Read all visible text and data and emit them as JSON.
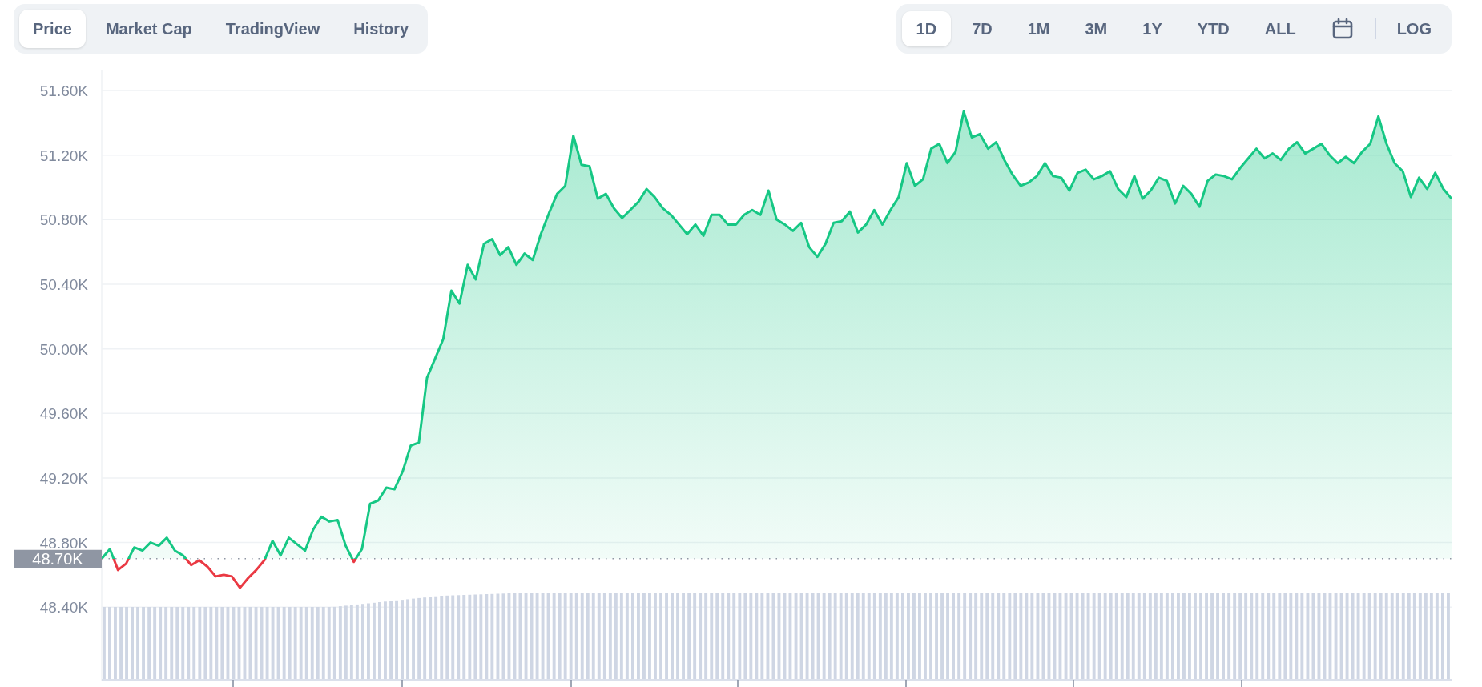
{
  "view_tabs": [
    {
      "label": "Price",
      "selected": true
    },
    {
      "label": "Market Cap",
      "selected": false
    },
    {
      "label": "TradingView",
      "selected": false
    },
    {
      "label": "History",
      "selected": false
    }
  ],
  "range_tabs": [
    {
      "label": "1D",
      "selected": true
    },
    {
      "label": "7D",
      "selected": false
    },
    {
      "label": "1M",
      "selected": false
    },
    {
      "label": "3M",
      "selected": false
    },
    {
      "label": "1Y",
      "selected": false
    },
    {
      "label": "YTD",
      "selected": false
    },
    {
      "label": "ALL",
      "selected": false
    }
  ],
  "log_button": {
    "label": "LOG",
    "selected": false
  },
  "chart": {
    "chart_data": {
      "type": "area",
      "ylim": [
        47.95,
        51.6
      ],
      "grid": true,
      "yticks": [
        {
          "value": 48.4,
          "label": "48.40K"
        },
        {
          "value": 48.8,
          "label": "48.80K"
        },
        {
          "value": 49.2,
          "label": "49.20K"
        },
        {
          "value": 49.6,
          "label": "49.60K"
        },
        {
          "value": 50.0,
          "label": "50.00K"
        },
        {
          "value": 50.4,
          "label": "50.40K"
        },
        {
          "value": 50.8,
          "label": "50.80K"
        },
        {
          "value": 51.2,
          "label": "51.20K"
        },
        {
          "value": 51.6,
          "label": "51.60K"
        }
      ],
      "series": [
        {
          "color": "#16c784",
          "values": [
            48.7,
            48.76,
            48.63,
            48.67,
            48.77,
            48.75,
            48.8,
            48.78,
            48.83,
            48.75,
            48.72,
            48.66,
            48.69,
            48.65,
            48.59,
            48.6,
            48.59,
            48.52,
            48.58,
            48.63,
            48.69,
            48.81,
            48.72,
            48.83,
            48.79,
            48.75,
            48.88,
            48.96,
            48.93,
            48.94,
            48.78,
            48.68,
            48.76,
            49.04,
            49.06,
            49.14,
            49.13,
            49.24,
            49.4,
            49.42,
            49.82,
            49.94,
            50.06,
            50.36,
            50.28,
            50.52,
            50.43,
            50.65,
            50.68,
            50.58,
            50.63,
            50.52,
            50.59,
            50.55,
            50.71,
            50.84,
            50.96,
            51.01,
            51.32,
            51.14,
            51.13,
            50.93,
            50.96,
            50.87,
            50.81,
            50.86,
            50.91,
            50.99,
            50.94,
            50.87,
            50.83,
            50.77,
            50.71,
            50.77,
            50.7,
            50.83,
            50.83,
            50.77,
            50.77,
            50.83,
            50.86,
            50.83,
            50.98,
            50.8,
            50.77,
            50.73,
            50.78,
            50.63,
            50.57,
            50.65,
            50.78,
            50.79,
            50.85,
            50.72,
            50.77,
            50.86,
            50.77,
            50.86,
            50.94,
            51.15,
            51.01,
            51.05,
            51.24,
            51.27,
            51.15,
            51.22,
            51.47,
            51.31,
            51.33,
            51.24,
            51.28,
            51.17,
            51.08,
            51.01,
            51.03,
            51.07,
            51.15,
            51.07,
            51.06,
            50.98,
            51.09,
            51.11,
            51.05,
            51.07,
            51.1,
            50.99,
            50.94,
            51.07,
            50.93,
            50.98,
            51.06,
            51.04,
            50.9,
            51.01,
            50.96,
            50.88,
            51.04,
            51.08,
            51.07,
            51.05,
            51.12,
            51.18,
            51.24,
            51.18,
            51.21,
            51.17,
            51.24,
            51.28,
            51.21,
            51.24,
            51.27,
            51.2,
            51.15,
            51.19,
            51.15,
            51.22,
            51.27,
            51.44,
            51.27,
            51.15,
            51.1,
            50.94,
            51.06,
            50.99,
            51.09,
            50.99,
            50.93
          ]
        }
      ],
      "ref_lines": [
        {
          "axis": "y",
          "value": 48.7,
          "label": "48.70K",
          "color": "#8f96a3"
        }
      ]
    }
  }
}
